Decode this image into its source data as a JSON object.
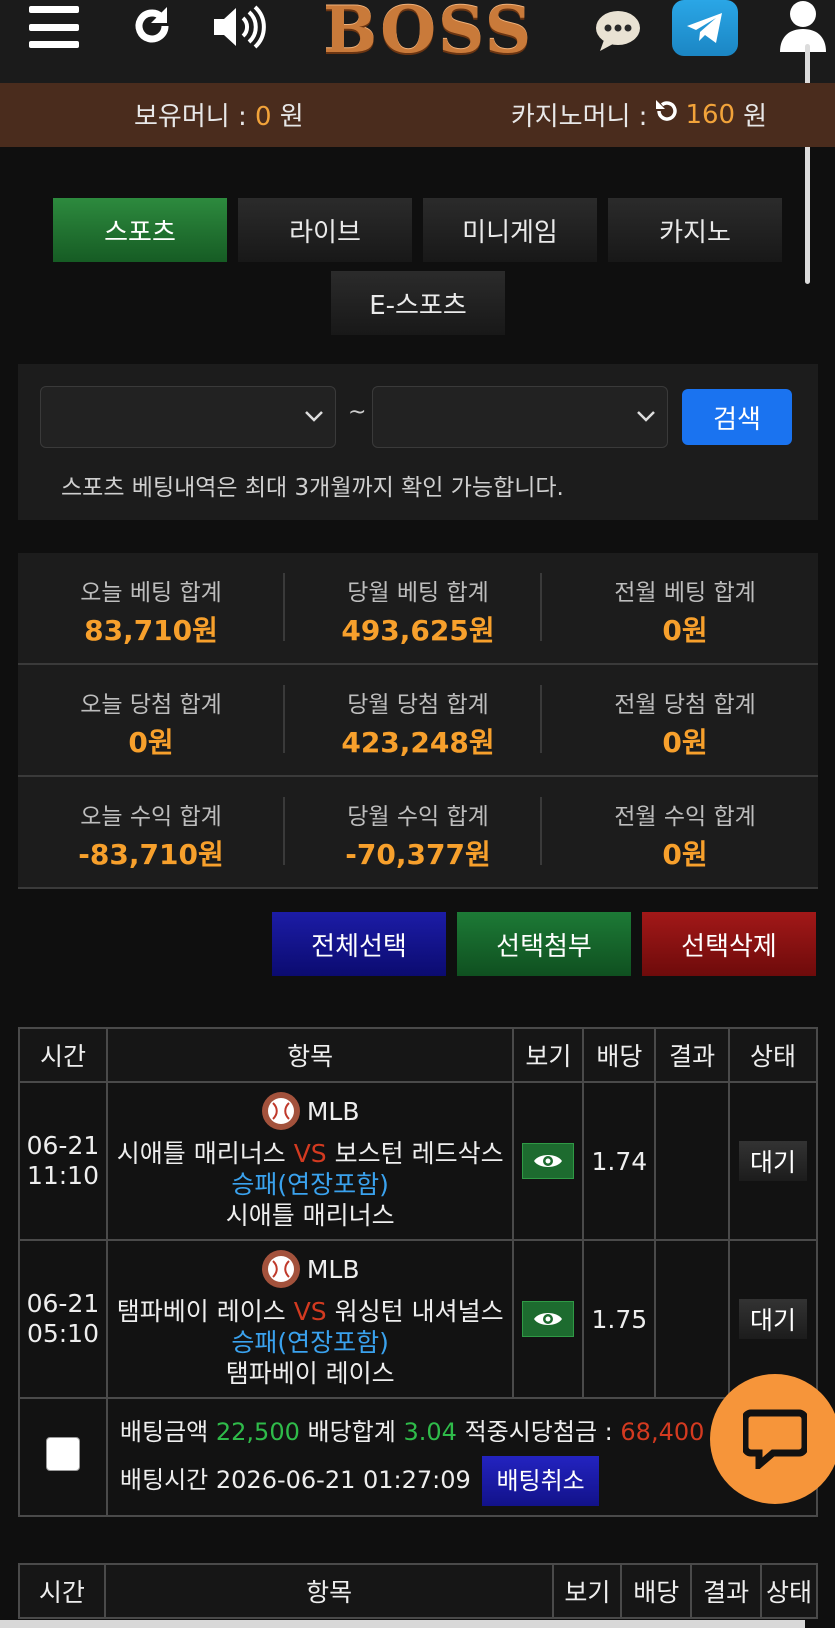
{
  "header": {
    "logo_text": "BOSS"
  },
  "money": {
    "holding_label": "보유머니 :",
    "holding_value": "0",
    "holding_unit": "원",
    "casino_label": "카지노머니 :",
    "casino_value": "160",
    "casino_unit": "원"
  },
  "tabs": [
    {
      "label": "스포츠",
      "active": true
    },
    {
      "label": "라이브",
      "active": false
    },
    {
      "label": "미니게임",
      "active": false
    },
    {
      "label": "카지노",
      "active": false
    },
    {
      "label": "E-스포츠",
      "active": false
    }
  ],
  "search": {
    "start_date": "",
    "end_date": "",
    "separator": "~",
    "button": "검색",
    "note": "스포츠 베팅내역은 최대 3개월까지 확인 가능합니다."
  },
  "stats": [
    [
      {
        "label": "오늘 베팅 합계",
        "value": "83,710원"
      },
      {
        "label": "당월 베팅 합계",
        "value": "493,625원"
      },
      {
        "label": "전월 베팅 합계",
        "value": "0원"
      }
    ],
    [
      {
        "label": "오늘 당첨 합계",
        "value": "0원"
      },
      {
        "label": "당월 당첨 합계",
        "value": "423,248원"
      },
      {
        "label": "전월 당첨 합계",
        "value": "0원"
      }
    ],
    [
      {
        "label": "오늘 수익 합계",
        "value": "-83,710원"
      },
      {
        "label": "당월 수익 합계",
        "value": "-70,377원"
      },
      {
        "label": "전월 수익 합계",
        "value": "0원"
      }
    ]
  ],
  "actions": {
    "select_all": "전체선택",
    "attach": "선택첨부",
    "delete": "선택삭제"
  },
  "table": {
    "headers": [
      "시간",
      "항목",
      "보기",
      "배당",
      "결과",
      "상태"
    ],
    "bets": [
      {
        "date": "06-21",
        "time": "11:10",
        "league": "MLB",
        "home": "시애틀 매리너스",
        "vs": "VS",
        "away": "보스턴 레드삭스",
        "market": "승패(연장포함)",
        "pick": "시애틀 매리너스",
        "odds": "1.74",
        "result": "",
        "status": "대기"
      },
      {
        "date": "06-21",
        "time": "05:10",
        "league": "MLB",
        "home": "탬파베이 레이스",
        "vs": "VS",
        "away": "워싱턴 내셔널스",
        "market": "승패(연장포함)",
        "pick": "탬파베이 레이스",
        "odds": "1.75",
        "result": "",
        "status": "대기"
      }
    ],
    "summary": {
      "amount_label": "배팅금액",
      "amount": "22,500",
      "total_odds_label": "배당합계",
      "total_odds": "3.04",
      "payout_label": "적중시당첨금 :",
      "payout": "68,400",
      "time_label": "배팅시간",
      "time": "2026-06-21 01:27:09",
      "cancel": "배팅취소"
    }
  },
  "next_table": {
    "headers": [
      "시간",
      "항목",
      "보기",
      "배당",
      "결과",
      "상태"
    ]
  }
}
